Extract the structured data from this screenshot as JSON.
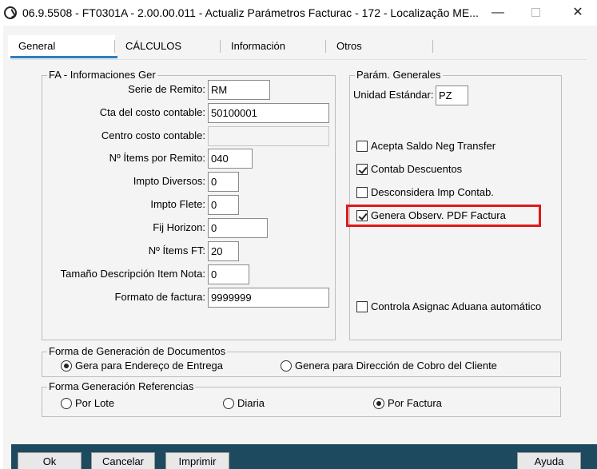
{
  "window": {
    "title": "06.9.5508 - FT0301A - 2.00.00.011 - Actualiz Parámetros Facturac - 172 - Localização ME...",
    "minimize": "—",
    "close": "✕"
  },
  "tabs": [
    {
      "label": "General"
    },
    {
      "label": "CÁLCULOS"
    },
    {
      "label": "Información"
    },
    {
      "label": "Otros"
    }
  ],
  "fa_group": {
    "title": "FA - Informaciones Ger",
    "fields": [
      {
        "label": "Serie de Remito:",
        "value": "RM"
      },
      {
        "label": "Cta del costo contable:",
        "value": "50100001"
      },
      {
        "label": "Centro costo contable:",
        "value": ""
      },
      {
        "label": "Nº Ítems por Remito:",
        "value": "040"
      },
      {
        "label": "Impto Diversos:",
        "value": "0"
      },
      {
        "label": "Impto Flete:",
        "value": "0"
      },
      {
        "label": "Fij Horizon:",
        "value": "0"
      },
      {
        "label": "Nº Ítems FT:",
        "value": "20"
      },
      {
        "label": "Tamaño Descripción Item Nota:",
        "value": "0"
      },
      {
        "label": "Formato de factura:",
        "value": "9999999"
      }
    ]
  },
  "param_group": {
    "title": "Parám. Generales",
    "unidad_label": "Unidad Estándar:",
    "unidad_value": "PZ",
    "checks": [
      {
        "label": "Acepta Saldo Neg Transfer",
        "checked": false
      },
      {
        "label": "Contab Descuentos",
        "checked": true
      },
      {
        "label": "Desconsidera Imp Contab.",
        "checked": false
      },
      {
        "label": "Genera Observ. PDF Factura",
        "checked": true
      },
      {
        "label": "Controla Asignac Aduana automático",
        "checked": false
      }
    ]
  },
  "docs_group": {
    "title": "Forma de Generación de Documentos",
    "options": [
      {
        "label": "Gera para Endereço de Entrega",
        "selected": true
      },
      {
        "label": "Genera para Dirección de Cobro del Cliente",
        "selected": false
      }
    ]
  },
  "ref_group": {
    "title": "Forma Generación Referencias",
    "options": [
      {
        "label": "Por Lote",
        "selected": false
      },
      {
        "label": "Diaria",
        "selected": false
      },
      {
        "label": "Por Factura",
        "selected": true
      }
    ]
  },
  "buttons": {
    "ok": "Ok",
    "cancel": "Cancelar",
    "print": "Imprimir",
    "help": "Ayuda"
  },
  "colors": {
    "tab_accent": "#2d7fc1",
    "highlight": "#e01818",
    "bottom_bar": "#1d4a5e"
  }
}
